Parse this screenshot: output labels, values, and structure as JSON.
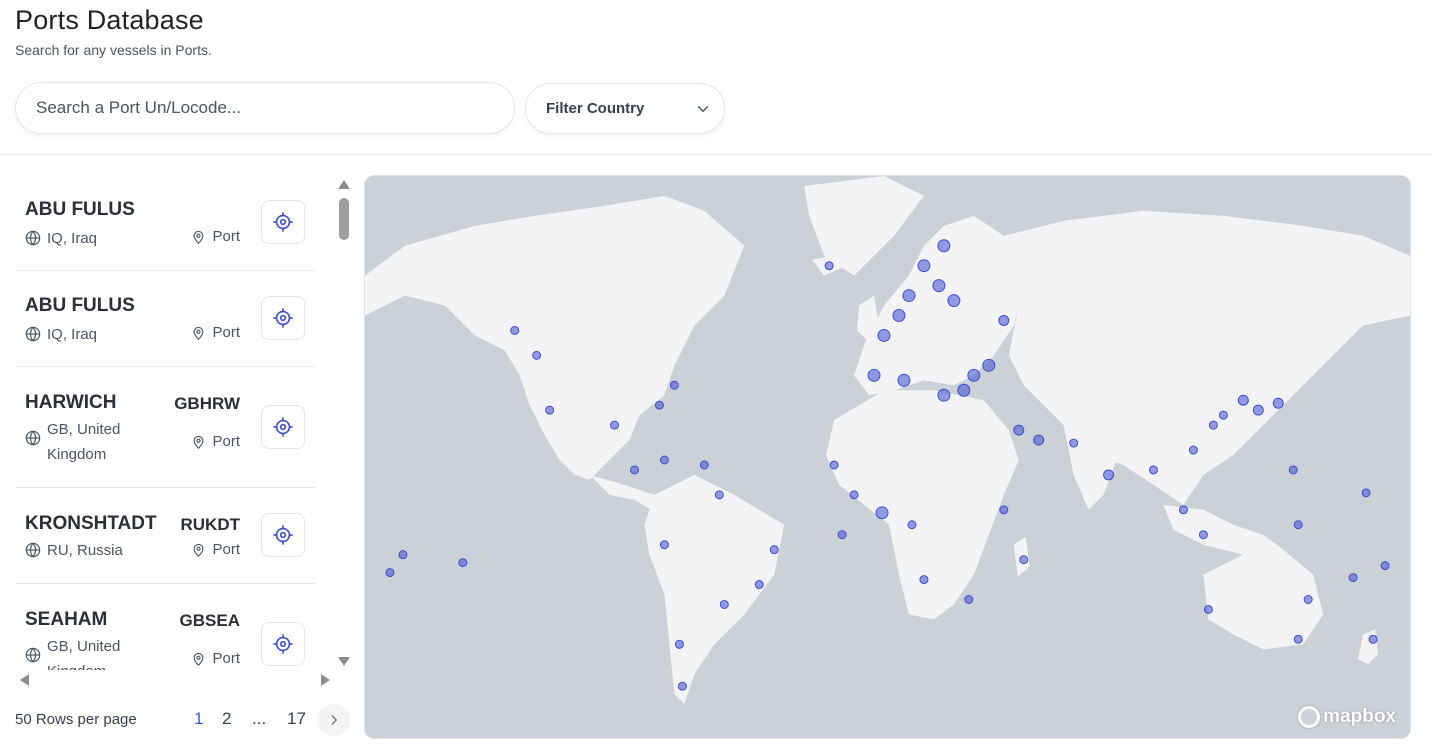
{
  "header": {
    "title": "Ports Database",
    "subtitle": "Search for any vessels in Ports."
  },
  "search": {
    "placeholder": "Search a Port Un/Locode...",
    "value": ""
  },
  "filter": {
    "label": "Filter Country"
  },
  "ports": [
    {
      "name": "ABU FULUS",
      "code": "",
      "country": "IQ, Iraq",
      "type": "Port"
    },
    {
      "name": "ABU FULUS",
      "code": "",
      "country": "IQ, Iraq",
      "type": "Port"
    },
    {
      "name": "HARWICH",
      "code": "GBHRW",
      "country": "GB, United Kingdom",
      "type": "Port"
    },
    {
      "name": "KRONSHTADT",
      "code": "RUKDT",
      "country": "RU, Russia",
      "type": "Port"
    },
    {
      "name": "SEAHAM",
      "code": "GBSEA",
      "country": "GB, United Kingdom",
      "type": "Port"
    }
  ],
  "pagination": {
    "rows_label": "50 Rows per page",
    "pages": [
      "1",
      "2",
      "...",
      "17"
    ],
    "current": "1"
  },
  "map": {
    "attribution": "mapbox",
    "colors": {
      "water": "#ccd1d8",
      "land": "#f4f4f6",
      "marker": "#3d4fd1"
    }
  }
}
